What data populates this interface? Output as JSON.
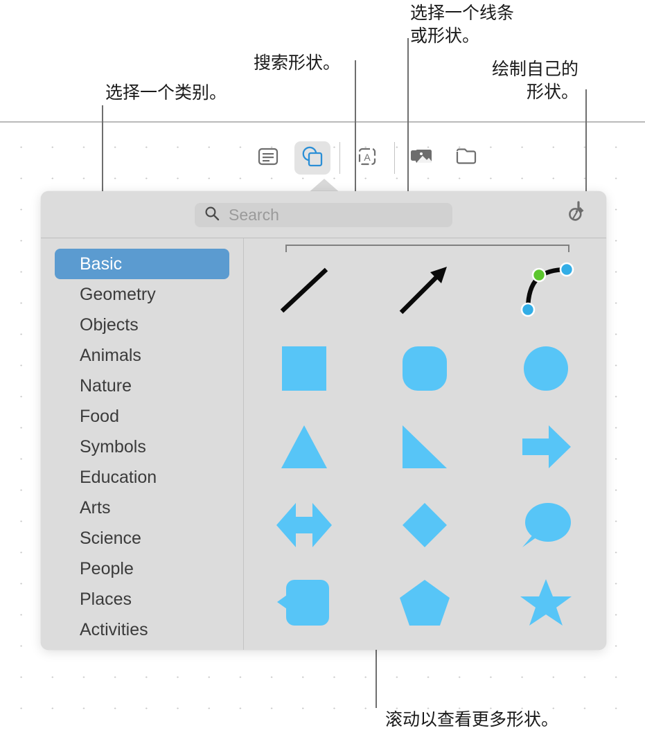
{
  "annotations": {
    "category": "选择一个类别。",
    "search": "搜索形状。",
    "pick_shape": "选择一个线条\n或形状。",
    "draw_own": "绘制自己的\n形状。",
    "scroll": "滚动以查看更多形状。"
  },
  "toolbar": {
    "items": [
      {
        "name": "text-tool",
        "icon": "text-box-icon",
        "selected": false
      },
      {
        "name": "shape-tool",
        "icon": "shapes-icon",
        "selected": true
      },
      {
        "name": "text-box-tool",
        "icon": "a-in-box-icon",
        "selected": false
      },
      {
        "name": "media-tool",
        "icon": "photos-icon",
        "selected": false
      },
      {
        "name": "file-tool",
        "icon": "folder-icon",
        "selected": false
      }
    ]
  },
  "popover": {
    "search": {
      "placeholder": "Search",
      "value": "",
      "icon": "search-icon"
    },
    "draw_button": {
      "label": "",
      "icon": "pen-icon"
    },
    "sidebar": {
      "selected": "Basic",
      "items": [
        "Basic",
        "Geometry",
        "Objects",
        "Animals",
        "Nature",
        "Food",
        "Symbols",
        "Education",
        "Arts",
        "Science",
        "People",
        "Places",
        "Activities"
      ]
    },
    "shapes": {
      "rows": [
        [
          "line",
          "arrow",
          "curved-connector"
        ],
        [
          "square",
          "rounded-rectangle",
          "circle"
        ],
        [
          "triangle",
          "right-triangle",
          "right-arrow"
        ],
        [
          "double-arrow",
          "diamond",
          "speech-bubble"
        ],
        [
          "callout-box",
          "pentagon",
          "star"
        ]
      ]
    }
  },
  "colors": {
    "shape_fill": "#57c5f7",
    "selection_blue": "#5b9bd0",
    "handle_blue": "#32ade6",
    "handle_green": "#5cc62e",
    "panel_bg": "#dcdcdc",
    "line_black": "#0a0a0a"
  }
}
